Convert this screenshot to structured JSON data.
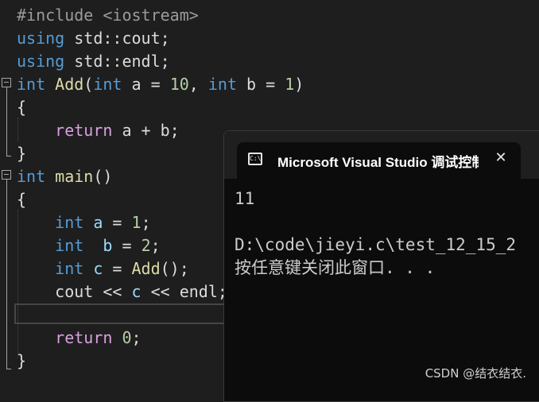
{
  "editor": {
    "lines": [
      {
        "id": "l1",
        "parts": [
          {
            "t": "#include ",
            "c": "pp"
          },
          {
            "t": "<iostream>",
            "c": "pp"
          }
        ]
      },
      {
        "id": "l2",
        "parts": [
          {
            "t": "using",
            "c": "kw"
          },
          {
            "t": " std::cout;",
            "c": ""
          }
        ]
      },
      {
        "id": "l3",
        "parts": [
          {
            "t": "using",
            "c": "kw"
          },
          {
            "t": " std::endl;",
            "c": ""
          }
        ]
      },
      {
        "id": "l4",
        "parts": [
          {
            "t": "int",
            "c": "kw"
          },
          {
            "t": " ",
            "c": ""
          },
          {
            "t": "Add",
            "c": "fn"
          },
          {
            "t": "(",
            "c": ""
          },
          {
            "t": "int",
            "c": "kw"
          },
          {
            "t": " a = ",
            "c": ""
          },
          {
            "t": "10",
            "c": "num"
          },
          {
            "t": ", ",
            "c": ""
          },
          {
            "t": "int",
            "c": "kw"
          },
          {
            "t": " b = ",
            "c": ""
          },
          {
            "t": "1",
            "c": "num"
          },
          {
            "t": ")",
            "c": ""
          }
        ]
      },
      {
        "id": "l5",
        "parts": [
          {
            "t": "{",
            "c": ""
          }
        ]
      },
      {
        "id": "l6",
        "parts": [
          {
            "t": "    ",
            "c": ""
          },
          {
            "t": "return",
            "c": "kw2"
          },
          {
            "t": " a + b;",
            "c": ""
          }
        ]
      },
      {
        "id": "l7",
        "parts": [
          {
            "t": "}",
            "c": ""
          }
        ]
      },
      {
        "id": "l8",
        "parts": [
          {
            "t": "int",
            "c": "kw"
          },
          {
            "t": " ",
            "c": ""
          },
          {
            "t": "main",
            "c": "fn"
          },
          {
            "t": "()",
            "c": ""
          }
        ]
      },
      {
        "id": "l9",
        "parts": [
          {
            "t": "{",
            "c": ""
          }
        ]
      },
      {
        "id": "l10",
        "parts": [
          {
            "t": "    ",
            "c": ""
          },
          {
            "t": "int",
            "c": "kw"
          },
          {
            "t": " ",
            "c": ""
          },
          {
            "t": "a",
            "c": "var"
          },
          {
            "t": " = ",
            "c": ""
          },
          {
            "t": "1",
            "c": "num"
          },
          {
            "t": ";",
            "c": ""
          }
        ]
      },
      {
        "id": "l11",
        "parts": [
          {
            "t": "    ",
            "c": ""
          },
          {
            "t": "int",
            "c": "kw"
          },
          {
            "t": "  ",
            "c": ""
          },
          {
            "t": "b",
            "c": "var"
          },
          {
            "t": " = ",
            "c": ""
          },
          {
            "t": "2",
            "c": "num"
          },
          {
            "t": ";",
            "c": ""
          }
        ]
      },
      {
        "id": "l12",
        "parts": [
          {
            "t": "    ",
            "c": ""
          },
          {
            "t": "int",
            "c": "kw"
          },
          {
            "t": " ",
            "c": ""
          },
          {
            "t": "c",
            "c": "var"
          },
          {
            "t": " = ",
            "c": ""
          },
          {
            "t": "Add",
            "c": "fn"
          },
          {
            "t": "();",
            "c": ""
          }
        ]
      },
      {
        "id": "l13",
        "parts": [
          {
            "t": "    cout << ",
            "c": ""
          },
          {
            "t": "c",
            "c": "var"
          },
          {
            "t": " << endl;",
            "c": ""
          }
        ]
      },
      {
        "id": "l14",
        "parts": [
          {
            "t": "",
            "c": ""
          }
        ]
      },
      {
        "id": "l15",
        "parts": [
          {
            "t": "    ",
            "c": ""
          },
          {
            "t": "return",
            "c": "kw2"
          },
          {
            "t": " ",
            "c": ""
          },
          {
            "t": "0",
            "c": "num"
          },
          {
            "t": ";",
            "c": ""
          }
        ]
      },
      {
        "id": "l16",
        "parts": [
          {
            "t": "}",
            "c": ""
          }
        ]
      }
    ]
  },
  "console": {
    "tab_title": "Microsoft Visual Studio 调试控制台",
    "icon_glyph": "C:\\",
    "close_glyph": "✕",
    "output": [
      "11",
      "",
      "D:\\code\\jieyi.c\\test_12_15_2",
      "按任意键关闭此窗口. . ."
    ]
  },
  "watermark": "CSDN @结衣结衣."
}
